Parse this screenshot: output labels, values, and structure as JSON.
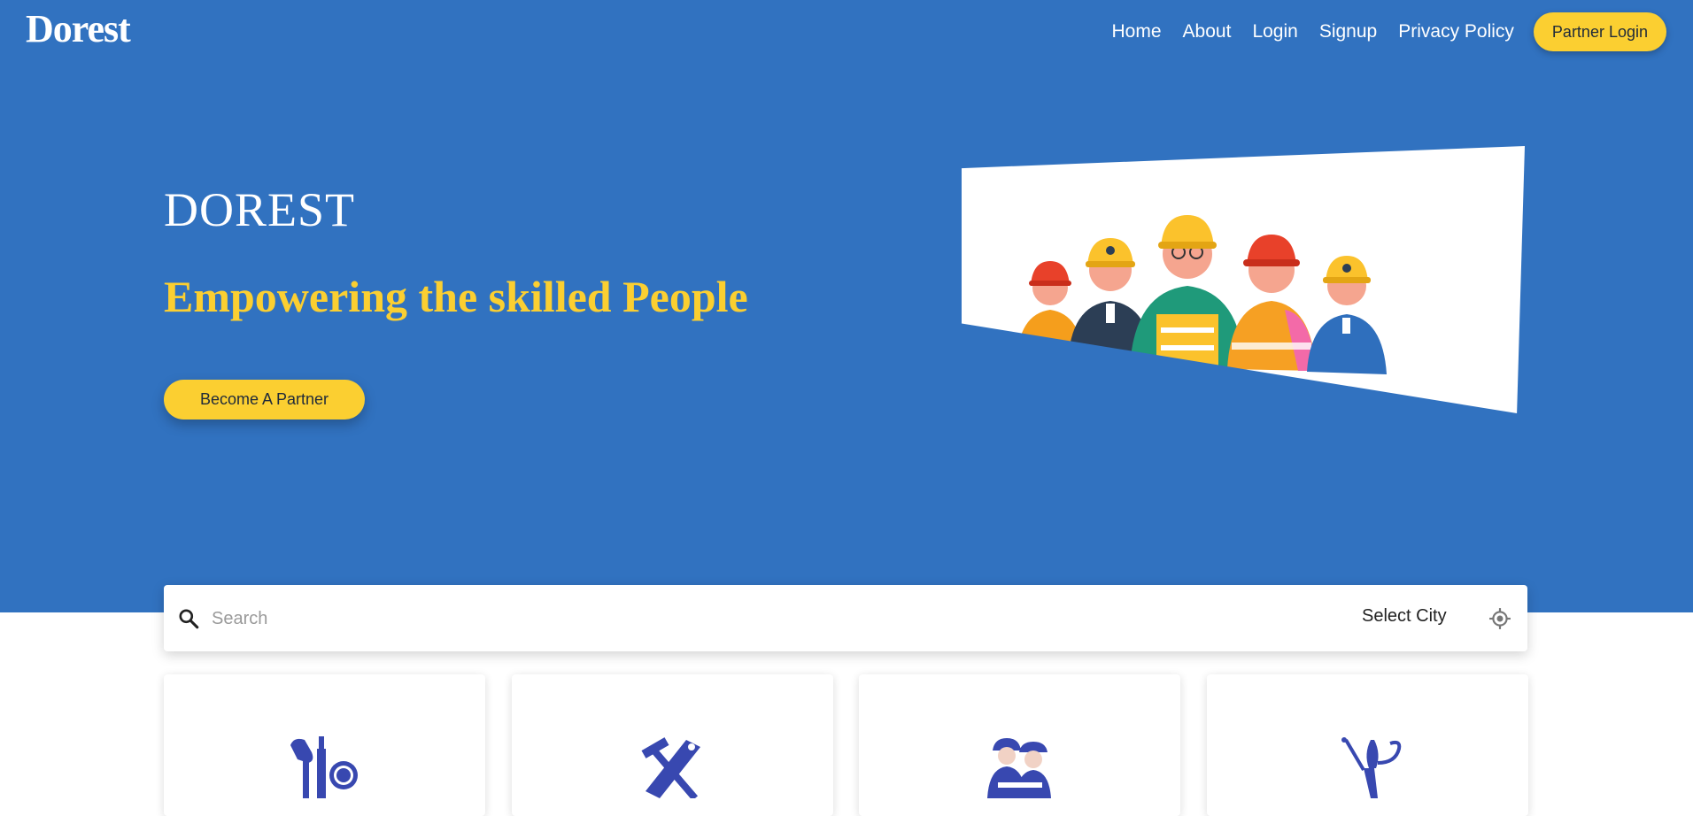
{
  "header": {
    "logo_text": "Dorest",
    "nav": [
      {
        "label": "Home"
      },
      {
        "label": "About"
      },
      {
        "label": "Login"
      },
      {
        "label": "Signup"
      },
      {
        "label": "Privacy Policy"
      }
    ],
    "partner_login_label": "Partner Login"
  },
  "hero": {
    "title": "DOREST",
    "tagline": "Empowering the skilled People",
    "cta_label": "Become A Partner",
    "image_icon": "workers-illustration"
  },
  "search": {
    "placeholder": "Search",
    "city_label": "Select City",
    "search_icon": "search-icon",
    "locate_icon": "locate-icon"
  },
  "categories": [
    {
      "icon": "makeup-icon"
    },
    {
      "icon": "carpentry-tools-icon"
    },
    {
      "icon": "mechanics-icon"
    },
    {
      "icon": "electrician-tools-icon"
    }
  ],
  "colors": {
    "hero_bg": "#3172c0",
    "accent": "#fbcf31",
    "icon_blue": "#3848b0"
  }
}
